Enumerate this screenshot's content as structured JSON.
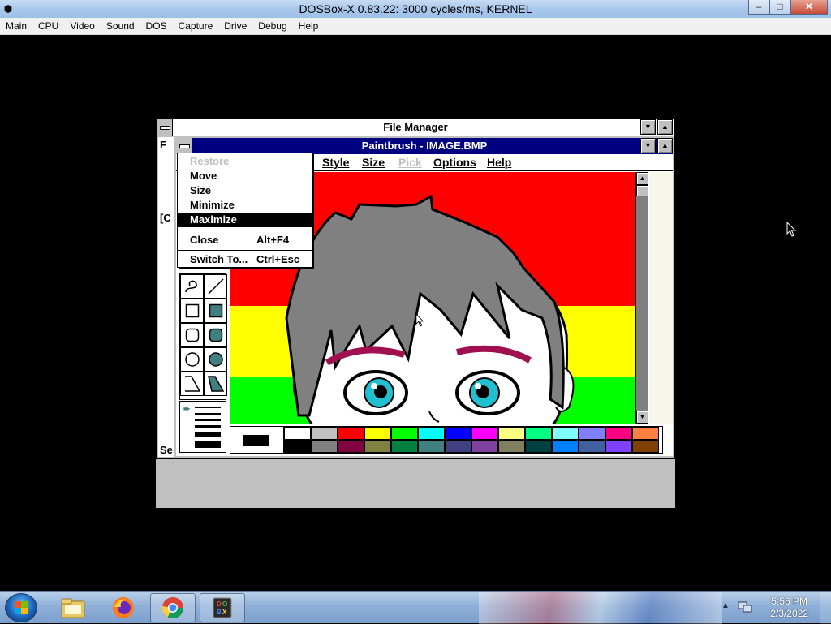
{
  "host_window": {
    "title": "DOSBox-X 0.83.22: 3000 cycles/ms, KERNEL",
    "controls": {
      "minimize": "–",
      "maximize": "□",
      "close": "✕"
    }
  },
  "host_menu": [
    "Main",
    "CPU",
    "Video",
    "Sound",
    "DOS",
    "Capture",
    "Drive",
    "Debug",
    "Help"
  ],
  "file_manager": {
    "title": "File Manager",
    "left_fragments": [
      "F",
      "[C",
      "Se"
    ]
  },
  "paintbrush": {
    "title": "Paintbrush - IMAGE.BMP",
    "menu": [
      {
        "label": "Style",
        "enabled": true
      },
      {
        "label": "Size",
        "enabled": true
      },
      {
        "label": "Pick",
        "enabled": false
      },
      {
        "label": "Options",
        "enabled": true
      },
      {
        "label": "Help",
        "enabled": true
      }
    ],
    "palette_colors": {
      "top": [
        "#ffffff",
        "#c0c0c0",
        "#ff0000",
        "#ffff00",
        "#00ff00",
        "#00ffff",
        "#0000ff",
        "#ff00ff",
        "#ffff80",
        "#00ff80",
        "#80ffff",
        "#8080ff",
        "#ff0080",
        "#ff8040"
      ],
      "bottom": [
        "#000000",
        "#808080",
        "#800040",
        "#808040",
        "#008040",
        "#408080",
        "#404080",
        "#8040a0",
        "#808060",
        "#004040",
        "#0080ff",
        "#4060a0",
        "#8040ff",
        "#804000"
      ]
    },
    "image_colors": {
      "stripe_top": "#ff0000",
      "stripe_mid": "#ffff00",
      "stripe_bottom": "#00ff00",
      "hair": "#808080",
      "eye": "#20c0d0"
    }
  },
  "control_menu": {
    "items": [
      {
        "label": "Restore",
        "accel": "",
        "state": "disabled"
      },
      {
        "label": "Move",
        "accel": "",
        "state": "normal"
      },
      {
        "label": "Size",
        "accel": "",
        "state": "normal"
      },
      {
        "label": "Minimize",
        "accel": "",
        "state": "normal"
      },
      {
        "label": "Maximize",
        "accel": "",
        "state": "selected"
      },
      {
        "label": "Close",
        "accel": "Alt+F4",
        "state": "normal"
      },
      {
        "label": "Switch To...",
        "accel": "Ctrl+Esc",
        "state": "normal"
      }
    ]
  },
  "taskbar": {
    "pinned": [
      "explorer-icon",
      "firefox-icon",
      "chrome-icon",
      "dosbox-icon"
    ],
    "tray_arrow": "▲",
    "time": "5:56 PM",
    "date": "2/3/2022"
  }
}
